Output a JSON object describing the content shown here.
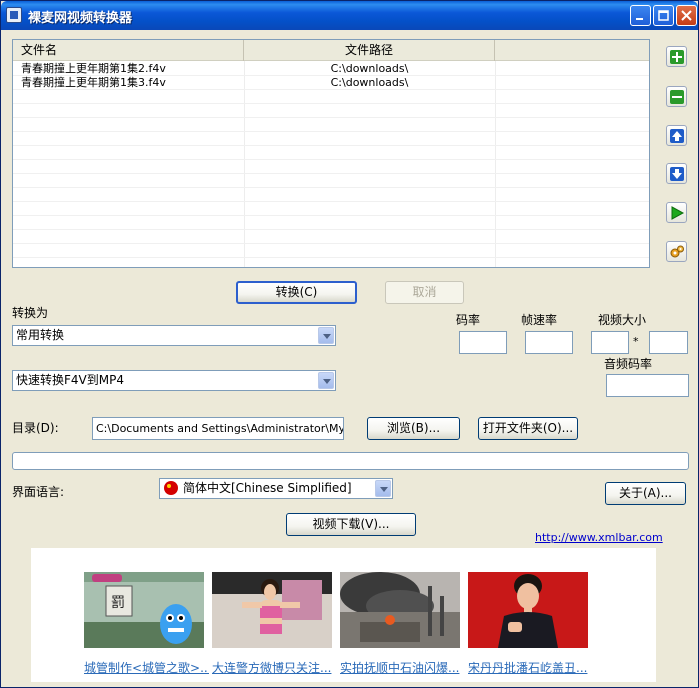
{
  "window": {
    "title": "裸麦网视频转换器"
  },
  "file_list": {
    "columns": [
      "文件名",
      "文件路径"
    ],
    "rows": [
      {
        "name": "青春期撞上更年期第1集2.f4v",
        "path": "C:\\downloads\\"
      },
      {
        "name": "青春期撞上更年期第1集3.f4v",
        "path": "C:\\downloads\\"
      }
    ]
  },
  "side_toolbar": {
    "icons": [
      "add-icon",
      "remove-icon",
      "move-up-icon",
      "move-down-icon",
      "play-icon",
      "settings-icon"
    ]
  },
  "actions": {
    "convert_label": "转换(C)",
    "cancel_label": "取消"
  },
  "conversion": {
    "label": "转换为",
    "mode": "常用转换",
    "preset": "快速转换F4V到MP4"
  },
  "params": {
    "bitrate_label": "码率",
    "framerate_label": "帧速率",
    "video_size_label": "视频大小",
    "size_separator": "*",
    "audio_bitrate_label": "音频码率",
    "bitrate": "",
    "framerate": "",
    "width": "",
    "height": "",
    "audio_bitrate": ""
  },
  "directory": {
    "label": "目录(D):",
    "value": "C:\\Documents and Settings\\Administrator\\My Docu",
    "browse_label": "浏览(B)...",
    "open_folder_label": "打开文件夹(O)..."
  },
  "progress": {
    "fraction": 0
  },
  "language": {
    "label": "界面语言:",
    "value": "简体中文[Chinese Simplified]",
    "about_label": "关于(A)..."
  },
  "download_label": "视频下载(V)...",
  "website": "http://www.xmlbar.com",
  "news": [
    {
      "caption": "城管制作<城管之歌>..."
    },
    {
      "caption": "大连警方微博只关注..."
    },
    {
      "caption": "实拍抚顺中石油闪爆..."
    },
    {
      "caption": "宋丹丹批潘石屹盖丑..."
    }
  ],
  "colors": {
    "titlebar": "#0450c8",
    "link": "#0000cc",
    "news_link": "#2a6ab8"
  }
}
